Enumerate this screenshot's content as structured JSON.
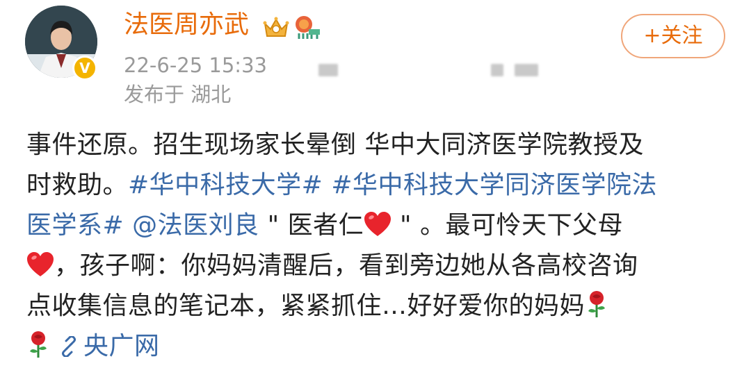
{
  "header": {
    "username": "法医周亦武",
    "timestamp": "22-6-25 15:33",
    "location": "发布于 湖北",
    "follow_label": "+关注",
    "verified_mark": "V"
  },
  "post": {
    "line1": "事件还原。招生现场家长晕倒 华中大同济医学院教授及",
    "line2_pre": "时救助。",
    "topic1": "#华中科技大学#",
    "line2_gap": " ",
    "topic2_part1": "#华中科技大学同济医学院法",
    "topic2_part2": "医学系#",
    "line3_gap": " ",
    "mention": "@法医刘良",
    "line3_text_a": " \" 医者仁",
    "line3_text_b": " \" 。最可怜天下父母",
    "line4_text": "，孩子啊：你妈妈清醒后，看到旁边她从各高校咨询",
    "line5_text": "点收集信息的笔记本，紧紧抓住…好好爱你的妈妈",
    "link_label": "央广网"
  },
  "colors": {
    "username": "#e86b0a",
    "link": "#3a6aa8",
    "text": "#222222",
    "meta": "#9a9a9a"
  },
  "icons": [
    "crown-vip-icon",
    "lion-member-icon",
    "heart-emoji",
    "rose-emoji",
    "link-icon"
  ]
}
